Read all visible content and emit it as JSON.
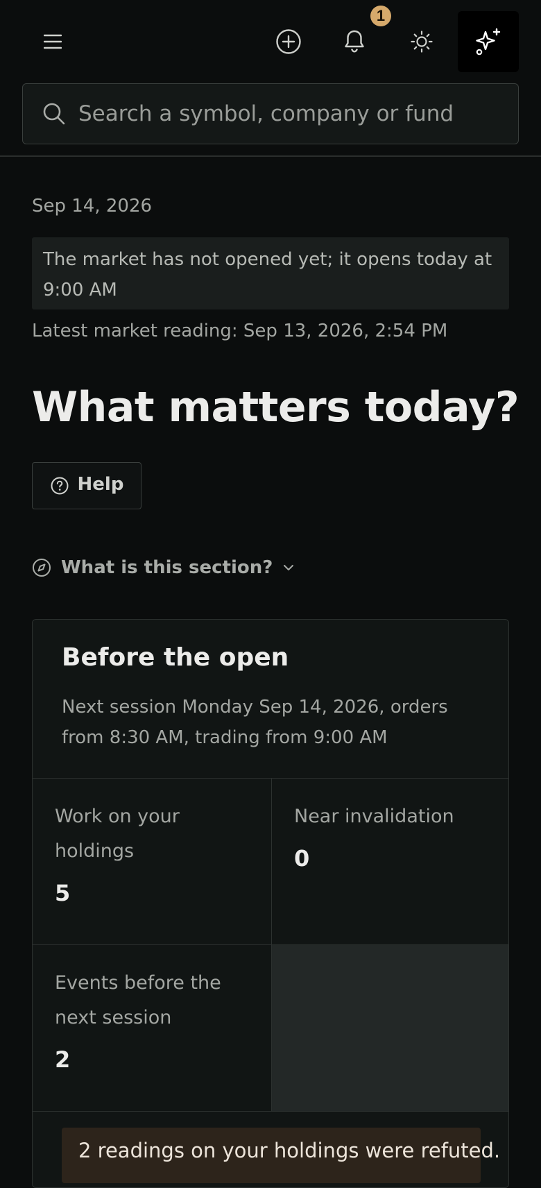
{
  "header": {
    "notification_count": "1",
    "icons": {
      "menu": "hamburger-menu-icon",
      "add": "plus-circle-icon",
      "notifications": "bell-icon",
      "theme": "sun-icon",
      "assistant": "sparkles-icon"
    }
  },
  "search": {
    "placeholder": "Search a symbol, company or fund",
    "value": ""
  },
  "main": {
    "date": "Sep 14, 2026",
    "market_notice": "The market has not opened yet; it opens today at 9:00 AM",
    "latest_reading": "Latest market reading: Sep 13, 2026, 2:54 PM",
    "heading": "What matters today?",
    "help_label": "Help",
    "section_toggle_label": "What is this section?"
  },
  "card": {
    "title": "Before the open",
    "subtitle": "Next session Monday Sep 14, 2026, orders from 8:30 AM, trading from 9:00 AM",
    "stats": [
      {
        "label": "Work on your holdings",
        "value": "5"
      },
      {
        "label": "Near invalidation",
        "value": "0"
      },
      {
        "label": "Events before the next session",
        "value": "2"
      }
    ],
    "alert": "2 readings on your holdings were refuted."
  },
  "colors": {
    "background": "#0b0d0d",
    "badge": "#d6a96b",
    "alert_bg": "#2d241b"
  }
}
